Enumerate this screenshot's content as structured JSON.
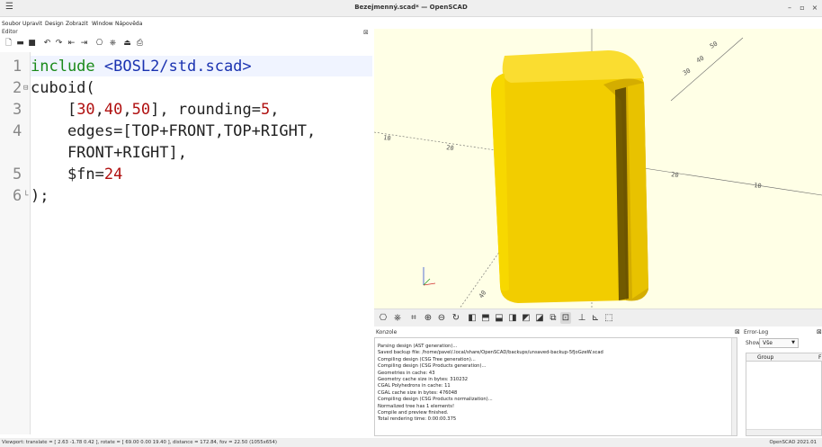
{
  "window": {
    "title": "Bezejmenný.scad* — OpenSCAD",
    "menu_icon": "hamburger-menu-icon"
  },
  "menu": {
    "items": [
      "Soubor",
      "Upravit",
      "Design",
      "Zobrazit",
      "Window",
      "Nápověda"
    ]
  },
  "editor": {
    "label": "Editor",
    "toolbar_icons": [
      "new-file-icon",
      "open-file-icon",
      "save-icon",
      "undo-icon",
      "redo-icon",
      "unindent-icon",
      "indent-icon",
      "preview-icon",
      "render-icon",
      "export-stl-icon",
      "send-to-print-icon"
    ],
    "lines": [
      {
        "num": "1",
        "fold": "",
        "tokens": [
          {
            "t": "include ",
            "c": "kw-green"
          },
          {
            "t": "<BOSL2/std.scad>",
            "c": "str-blue"
          }
        ]
      },
      {
        "num": "2",
        "fold": "⊟",
        "tokens": [
          {
            "t": "cuboid(",
            "c": "plain"
          }
        ]
      },
      {
        "num": "3",
        "fold": "",
        "tokens": [
          {
            "t": "    [",
            "c": "plain"
          },
          {
            "t": "30",
            "c": "num-red"
          },
          {
            "t": ",",
            "c": "plain"
          },
          {
            "t": "40",
            "c": "num-red"
          },
          {
            "t": ",",
            "c": "plain"
          },
          {
            "t": "50",
            "c": "num-red"
          },
          {
            "t": "], rounding=",
            "c": "plain"
          },
          {
            "t": "5",
            "c": "num-red"
          },
          {
            "t": ",",
            "c": "plain"
          }
        ]
      },
      {
        "num": "4",
        "fold": "",
        "tokens": [
          {
            "t": "    edges=[TOP+FRONT,TOP+RIGHT,",
            "c": "plain"
          }
        ]
      },
      {
        "num": "",
        "fold": "",
        "tokens": [
          {
            "t": "    FRONT+RIGHT],",
            "c": "plain"
          }
        ]
      },
      {
        "num": "5",
        "fold": "",
        "tokens": [
          {
            "t": "    $fn=",
            "c": "plain"
          },
          {
            "t": "24",
            "c": "num-red"
          }
        ]
      },
      {
        "num": "6",
        "fold": "└",
        "tokens": [
          {
            "t": ");",
            "c": "plain"
          }
        ]
      }
    ]
  },
  "viewport": {
    "axis_labels": [
      "50",
      "40",
      "30",
      "20",
      "10",
      "10",
      "20",
      "30",
      "50",
      "40",
      "20",
      "10"
    ],
    "model_color": "#f5d000",
    "model_dark_color": "#b89400",
    "background_color": "#ffffe6"
  },
  "viewport_toolbar": {
    "icons": [
      "preview-icon",
      "render-icon",
      "view-all-icon",
      "zoom-in-icon",
      "zoom-out-icon",
      "reset-view-icon",
      "view-right-icon",
      "view-top-icon",
      "view-bottom-icon",
      "view-left-icon",
      "view-front-icon",
      "view-back-icon",
      "perspective-icon",
      "orthogonal-icon",
      "show-axes-icon",
      "show-scale-icon",
      "show-edges-icon"
    ]
  },
  "console": {
    "title": "Konzole",
    "lines": [
      "Parsing design (AST generation)...",
      "Saved backup file: /home/pavel/.local/share/OpenSCAD/backups/unsaved-backup-5fJoGzeW.scad",
      "Compiling design (CSG Tree generation)...",
      "Compiling design (CSG Products generation)...",
      "Geometries in cache: 43",
      "Geometry cache size in bytes: 310232",
      "CGAL Polyhedrons in cache: 11",
      "CGAL cache size in bytes: 476048",
      "Compiling design (CSG Products normalization)...",
      "Normalized tree has 1 elements!",
      "Compile and preview finished.",
      "Total rendering time: 0:00:00.375"
    ]
  },
  "error_log": {
    "title": "Error-Log",
    "show_label": "Show",
    "show_value": "Vše",
    "column_group": "Group",
    "column_file": "F"
  },
  "statusbar": {
    "left": "Viewport: translate = [ 2.63 -1.78 0.42 ], rotate = [ 69.00 0.00 19.40 ], distance = 172.84, fov = 22.50 (1055x654)",
    "right": "OpenSCAD 2021.01"
  }
}
